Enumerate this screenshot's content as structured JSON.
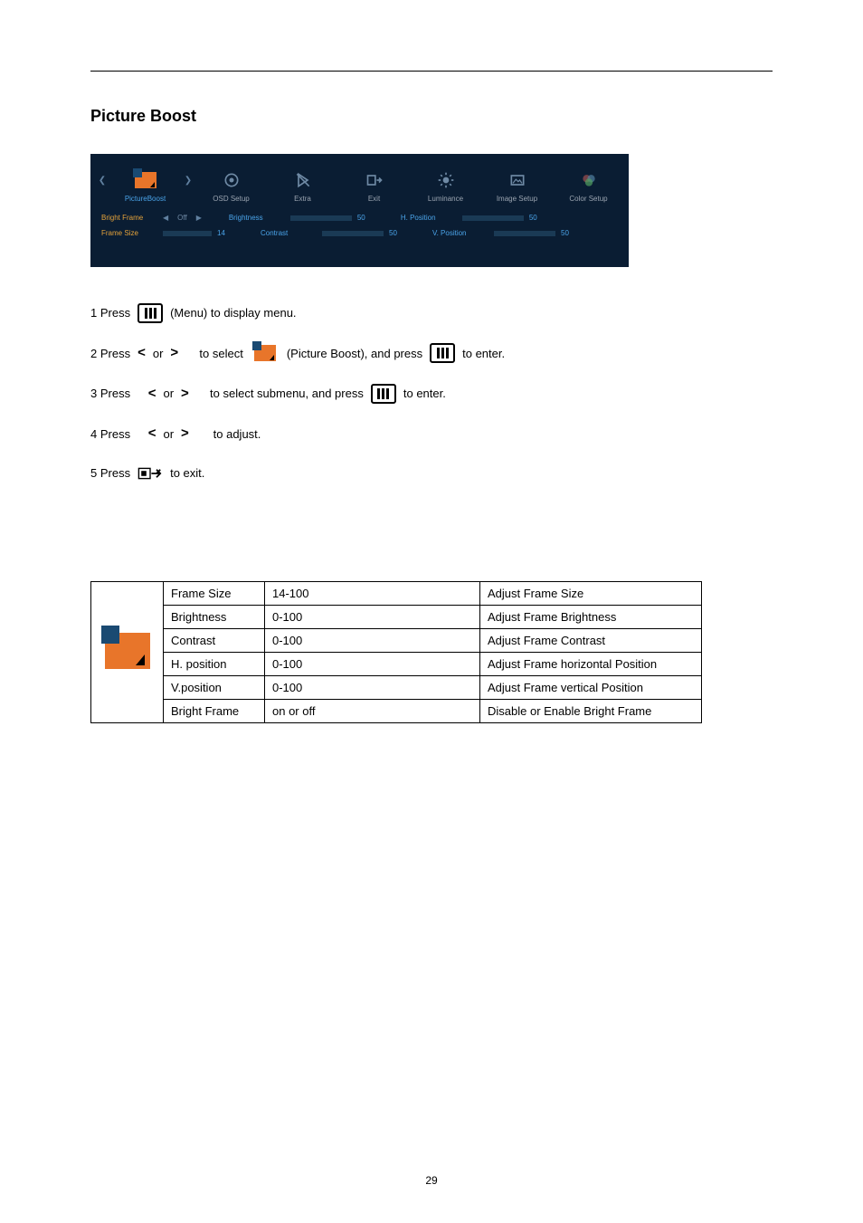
{
  "section_title": "Picture Boost",
  "osd": {
    "tabs": [
      {
        "label": "PictureBoost"
      },
      {
        "label": "OSD Setup"
      },
      {
        "label": "Extra"
      },
      {
        "label": "Exit"
      },
      {
        "label": "Luminance"
      },
      {
        "label": "Image Setup"
      },
      {
        "label": "Color Setup"
      }
    ],
    "settings": {
      "bright_frame": {
        "label": "Bright Frame",
        "value": "Off"
      },
      "brightness": {
        "label": "Brightness",
        "value": "50",
        "fill": 50
      },
      "hposition": {
        "label": "H. Position",
        "value": "50",
        "fill": 50
      },
      "frame_size": {
        "label": "Frame Size",
        "value": "14",
        "fill": 14
      },
      "contrast": {
        "label": "Contrast",
        "value": "50",
        "fill": 50
      },
      "vposition": {
        "label": "V. Position",
        "value": "50",
        "fill": 50
      }
    }
  },
  "instructions": {
    "step1_a": "1 Press",
    "step1_b": "(Menu) to display menu.",
    "step2_a": "2 Press",
    "step2_or": "or",
    "step2_b": "to select",
    "step2_c": "(Picture Boost), and press",
    "step2_d": "to enter.",
    "step3_a": "3 Press",
    "step3_b": "to select submenu, and press",
    "step3_d": "to enter.",
    "step4_a": "4 Press",
    "step4_b": "to adjust.",
    "step5_a": "5 Press",
    "step5_b": "to exit."
  },
  "table": {
    "rows": [
      {
        "name": "Frame Size",
        "range": "14-100",
        "desc": "Adjust Frame Size"
      },
      {
        "name": "Brightness",
        "range": "0-100",
        "desc": "Adjust Frame Brightness"
      },
      {
        "name": "Contrast",
        "range": "0-100",
        "desc": "Adjust Frame Contrast"
      },
      {
        "name": "H.  position",
        "range": "0-100",
        "desc": "Adjust Frame horizontal Position"
      },
      {
        "name": "V.position",
        "range": "0-100",
        "desc": "Adjust Frame vertical Position"
      },
      {
        "name": "Bright Frame",
        "range": "on or off",
        "desc": "Disable or Enable Bright Frame"
      }
    ]
  },
  "page_number": "29"
}
